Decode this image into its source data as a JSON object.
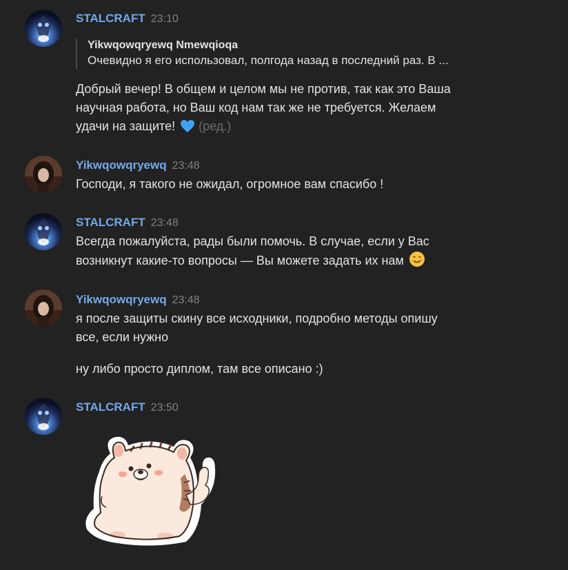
{
  "messages": [
    {
      "author": "STALCRAFT",
      "time": "23:10",
      "reply": {
        "author": "Yikwqowqryewq Nmewqioqa",
        "text": "Очевидно я его использовал, полгода назад в последний раз. В ..."
      },
      "lines": [
        "Добрый вечер! В общем и целом мы не против, так как это Ваша",
        "научная работа, но Ваш код нам так же не требуется. Желаем",
        "удачи на защите!"
      ],
      "edited": "(ред.)"
    },
    {
      "author": "Yikwqowqryewq",
      "time": "23:48",
      "lines": [
        "Господи, я такого не ожидал, огромное вам спасибо !"
      ]
    },
    {
      "author": "STALCRAFT",
      "time": "23:48",
      "lines": [
        "Всегда пожалуйста, рады были помочь. В случае, если у Вас",
        "возникнут какие-то вопросы — Вы можете задать их нам"
      ]
    },
    {
      "author": "Yikwqowqryewq",
      "time": "23:48",
      "lines": [
        "я после защиты скину все исходники, подробно методы опишу",
        "все, если нужно"
      ],
      "extra": "ну либо просто диплом, там все описано :)"
    },
    {
      "author": "STALCRAFT",
      "time": "23:50",
      "sticker": "hedgehog-thumbs-up"
    }
  ],
  "colors": {
    "background": "#222222",
    "author": "#71aaeb",
    "time": "#828282",
    "text": "#e1e3e6"
  },
  "icons": [
    "blue-heart-emoji",
    "smiling-face-emoji"
  ]
}
